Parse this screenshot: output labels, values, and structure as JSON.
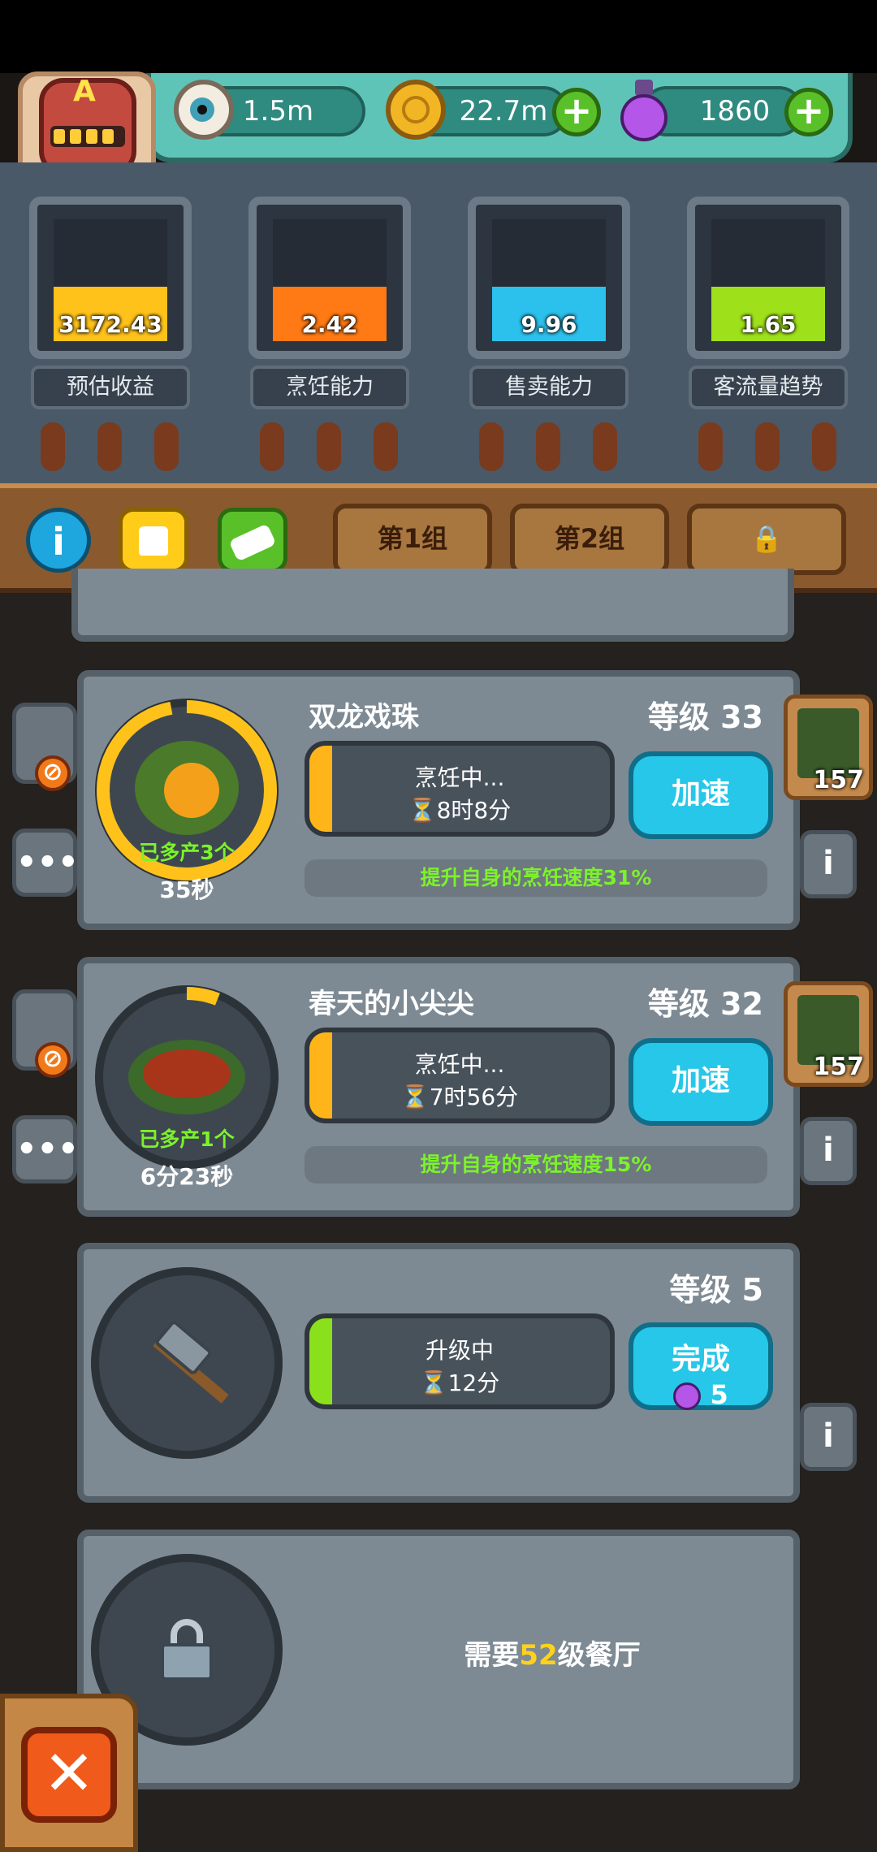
{
  "resources": {
    "eyes": "1.5m",
    "coins": "22.7m",
    "potions": "1860",
    "plus": "+"
  },
  "avatar": {
    "letter": "A"
  },
  "meters": [
    {
      "value": "3172.43",
      "label": "预估收益",
      "fill": 0.45,
      "color": "#ffc21a"
    },
    {
      "value": "2.42",
      "label": "烹饪能力",
      "fill": 0.45,
      "color": "#ff7a14"
    },
    {
      "value": "9.96",
      "label": "售卖能力",
      "fill": 0.45,
      "color": "#2cc0ec"
    },
    {
      "value": "1.65",
      "label": "客流量趋势",
      "fill": 0.45,
      "color": "#9ee01a"
    }
  ],
  "toolbar": {
    "info": "i",
    "group1": "第1组",
    "group2": "第2组",
    "lock": "🔒"
  },
  "dishes": [
    {
      "title": "双龙戏珠",
      "level": "等级 33",
      "status": "烹饪中...",
      "time": "⏳8时8分",
      "button": "加速",
      "bonus": "提升自身的烹饪速度31%",
      "extra": "已多产3个",
      "timer": "35秒",
      "card_count": "157",
      "ring_progress": 0.97
    },
    {
      "title": "春天的小尖尖",
      "level": "等级 32",
      "status": "烹饪中...",
      "time": "⏳7时56分",
      "button": "加速",
      "bonus": "提升自身的烹饪速度15%",
      "extra": "已多产1个",
      "timer": "6分23秒",
      "card_count": "157",
      "ring_progress": 0.06
    }
  ],
  "upgrade": {
    "level": "等级 5",
    "status": "升级中",
    "time": "⏳12分",
    "button": "完成",
    "cost": "5"
  },
  "locked": {
    "prefix": "需要",
    "level": "52",
    "suffix": "级餐厅"
  },
  "close": "✕",
  "info_symbol": "i",
  "dots_symbol": "•••",
  "no_symbol": "⊘"
}
